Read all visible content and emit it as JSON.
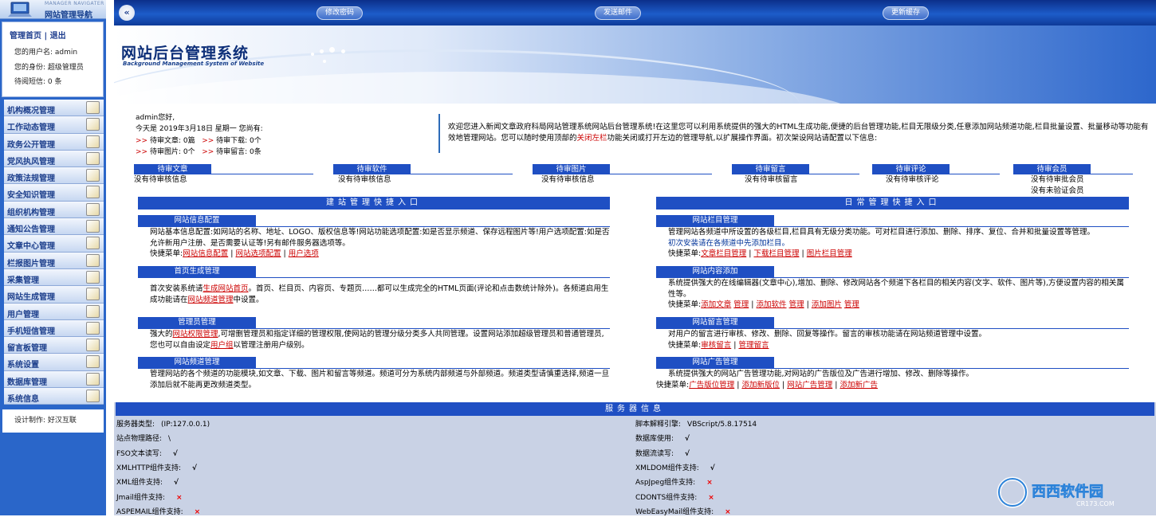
{
  "sidebar": {
    "logo_sub": "MANAGER NAVIGATER",
    "logo_title": "网站管理导航",
    "links": "管理首页 | 退出",
    "username_label": "您的用户名:",
    "username": "admin",
    "role_label": "您的身份:",
    "role": "超级管理员",
    "msg_label": "待阅短信:",
    "msg_count": "0 条",
    "menu": [
      {
        "label": "机构概况管理",
        "icon": "notepad-icon"
      },
      {
        "label": "工作动态管理",
        "icon": "notepad-icon"
      },
      {
        "label": "政务公开管理",
        "icon": "notepad-icon"
      },
      {
        "label": "党风执风管理",
        "icon": "notepad-icon"
      },
      {
        "label": "政策法规管理",
        "icon": "notepad-icon"
      },
      {
        "label": "安全知识管理",
        "icon": "notepad-icon"
      },
      {
        "label": "组织机构管理",
        "icon": "notepad-icon"
      },
      {
        "label": "通知公告管理",
        "icon": "notepad-icon"
      },
      {
        "label": "文章中心管理",
        "icon": "notepad-icon"
      },
      {
        "label": "栏报图片管理",
        "icon": "image-icon"
      },
      {
        "label": "采集管理",
        "icon": "refresh-icon"
      },
      {
        "label": "网站生成管理",
        "icon": "globe-icon"
      },
      {
        "label": "用户管理",
        "icon": "user-icon"
      },
      {
        "label": "手机短信管理",
        "icon": "phone-icon"
      },
      {
        "label": "留言板管理",
        "icon": "message-icon"
      },
      {
        "label": "系统设置",
        "icon": "tools-icon"
      },
      {
        "label": "数据库管理",
        "icon": "lock-icon"
      },
      {
        "label": "系统信息",
        "icon": "gears-icon"
      }
    ],
    "credit_label": "设计制作:",
    "credit": "好汉互联"
  },
  "topbar": {
    "back_glyph": "«",
    "btn_password": "修改密码",
    "btn_mail": "发送邮件",
    "btn_cache": "更新缓存"
  },
  "banner": {
    "title": "网站后台管理系统",
    "subtitle": "Background Management System of Website"
  },
  "welcome": {
    "greeting": "admin您好,",
    "date_line": "今天是 2019年3月18日 星期一 您尚有:",
    "row1a": "待审文章: 0篇",
    "row1b": "待审下载: 0个",
    "row2a": "待审图片: 0个",
    "row2b": "待审留言: 0条",
    "marker": ">>"
  },
  "intro": {
    "text1": "欢迎您进入新闻文章政府科局网站管理系统网站后台管理系统!在这里您可以利用系统提供的强大的HTML生成功能,便捷的后台管理功能,栏目无限级分类,任意添加网站频道功能,栏目批量设置、批量移动等功能有效地管理网站。您可以随时使用顶部的",
    "link": "关闭左栏",
    "text2": "功能关闭或打开左边的管理导航,以扩展操作界面。初次架设网站请配置以下信息:"
  },
  "pending": [
    {
      "title": "待审文章",
      "value": "没有待审核信息"
    },
    {
      "title": "待审软件",
      "value": "没有待审核信息"
    },
    {
      "title": "待审图片",
      "value": "没有待审核信息"
    },
    {
      "title": "待审留言",
      "value": "没有待审核留言"
    },
    {
      "title": "待审评论",
      "value": "没有待审核评论"
    },
    {
      "title": "待审会员",
      "value": "没有待审批会员",
      "value2": "没有未验证会员"
    }
  ],
  "left_section": {
    "title": "建站管理快捷入口",
    "site_info": {
      "title": "网站信息配置",
      "desc": "网站基本信息配置:如网站的名称、地址、LOGO、版权信息等!网站功能选项配置:如是否显示频道、保存远程图片等!用户选项配置:如是否允许新用户注册、是否需要认证等!另有邮件服务器选项等。",
      "menu_label": "快捷菜单:",
      "l1": "网站信息配置",
      "l2": "网站选项配置",
      "l3": "用户选项"
    },
    "homepage": {
      "title": "首页生成管理",
      "t1": "首次安装系统请",
      "l1": "生成网站首页",
      "t2": "。首页、栏目页、内容页、专题页……都可以生成完全的HTML页面(评论和点击数统计除外)。各频道启用生成功能请在",
      "l2": "网站频道管理",
      "t3": "中设置。"
    },
    "admin": {
      "title": "管理员管理",
      "t1": "强大的",
      "l1": "网站权限管理",
      "t2": ",可增删管理员和指定详细的管理权限,使网站的管理分级分类多人共同管理。设置网站添加",
      "l2": "超级管理员",
      "t3": "和",
      "l3": "普通管理员",
      "t4": ",您也可以自由设定",
      "l4": "用户组",
      "t5": "以管理注册用户级别。"
    },
    "channel": {
      "title": "网站频道管理",
      "t1": "管理网站的各个频道的功能模块,如文章、下载、图片和留言等频道。频道可分为",
      "l1": "系统内部频道",
      "t2": "与",
      "l2": "外部频道",
      "t3": "。频道类型请慎重选择,频道一旦添加后就不能再更改频道类型。"
    }
  },
  "right_section": {
    "title": "日常管理快捷入口",
    "column": {
      "title": "网站栏目管理",
      "desc": "管理网站各频道中所设置的各级栏目,栏目具有无级分类功能。可对栏目进行添加、删除、排序、复位、合并和批量设置等管理。",
      "note": "初次安装请在各频道中先添加栏目。",
      "menu_label": "快捷菜单:",
      "l1": "文章栏目管理",
      "l2": "下载栏目管理",
      "l3": "图片栏目管理"
    },
    "content": {
      "title": "网站内容添加",
      "t1": "系统提供强大的",
      "l1": "在线编辑器",
      "t2": "(文章中心),增加、删除、修改网站各个频道下各栏目的相关内容(文字、软件、图片等),方便设置内容的相关属性等。",
      "menu_label": "快捷菜单:",
      "a1": "添加文章",
      "m1": "管理",
      "a2": "添加软件",
      "m2": "管理",
      "a3": "添加图片",
      "m3": "管理"
    },
    "guestbook": {
      "title": "网站留言管理",
      "t1": "对用户的留言进行审核、修改、删除、回复等操作。留言的审核功能请在",
      "l1": "网站频道管理",
      "t2": "中设置。",
      "menu_label": "快捷菜单:",
      "q1": "审核留言",
      "q2": "管理留言"
    },
    "ads": {
      "title": "网站广告管理",
      "t1": "系统提供强大的",
      "l1": "网站广告管理",
      "t2": "功能,对网站的广告版位及广告进行增加、修改、删除等操作。",
      "menu_label": "快捷菜单:",
      "q1": "广告版位管理",
      "q2": "添加新版位",
      "q3": "网站广告管理",
      "q4": "添加新广告"
    }
  },
  "server": {
    "title": "服务器信息",
    "left": [
      {
        "label": "服务器类型:",
        "value": "(IP:127.0.0.1)",
        "status": ""
      },
      {
        "label": "站点物理路径:",
        "value": "\\",
        "status": ""
      },
      {
        "label": "FSO文本读写:",
        "value": "",
        "status": "ok"
      },
      {
        "label": "XMLHTTP组件支持:",
        "value": "",
        "status": "ok"
      },
      {
        "label": "XML组件支持:",
        "value": "",
        "status": "ok"
      },
      {
        "label": "Jmail组件支持:",
        "value": "",
        "status": "no"
      },
      {
        "label": "ASPEMAIL组件支持:",
        "value": "",
        "status": "no"
      }
    ],
    "right": [
      {
        "label": "脚本解释引擎:",
        "value": "VBScript/5.8.17514",
        "status": ""
      },
      {
        "label": "数据库使用:",
        "value": "",
        "status": "ok"
      },
      {
        "label": "数据流读写:",
        "value": "",
        "status": "ok"
      },
      {
        "label": "XMLDOM组件支持:",
        "value": "",
        "status": "ok"
      },
      {
        "label": "AspJpeg组件支持:",
        "value": "",
        "status": "no"
      },
      {
        "label": "CDONTS组件支持:",
        "value": "",
        "status": "no"
      },
      {
        "label": "WebEasyMail组件支持:",
        "value": "",
        "status": "no"
      }
    ],
    "ok_glyph": "√",
    "no_glyph": "×"
  },
  "watermark": {
    "brand": "西西软件园",
    "url": "CR173.COM"
  }
}
